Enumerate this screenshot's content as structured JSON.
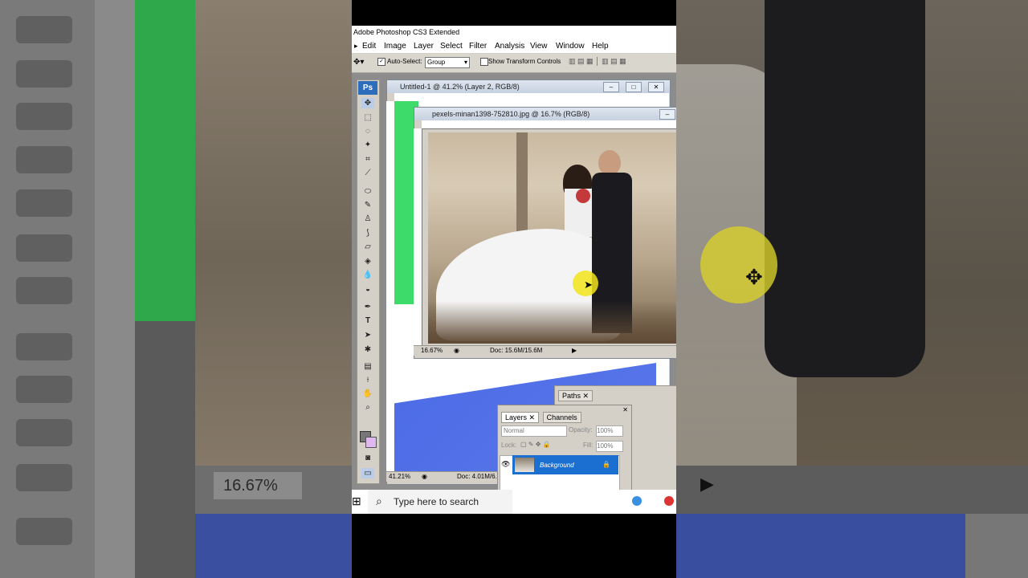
{
  "app": {
    "title": "Adobe Photoshop CS3 Extended"
  },
  "menu": [
    "Edit",
    "Image",
    "Layer",
    "Select",
    "Filter",
    "Analysis",
    "View",
    "Window",
    "Help"
  ],
  "options": {
    "auto_select_label": "Auto-Select:",
    "auto_select_value": "Group",
    "transform_label": "Show Transform Controls"
  },
  "doc_untitled": {
    "title": "Untitled-1 @ 41.2% (Layer 2, RGB/8)",
    "zoom": "41.21%",
    "doc_info": "Doc: 4.01M/6..."
  },
  "doc_photo": {
    "title": "pexels-minan1398-752810.jpg @ 16.7% (RGB/8)",
    "zoom": "16.67%",
    "doc_info": "Doc: 15.6M/15.6M"
  },
  "paths_tab": "Paths",
  "layers_panel": {
    "tabs": [
      "Layers",
      "Channels"
    ],
    "blend_mode": "Normal",
    "opacity_label": "Opacity:",
    "opacity_value": "100%",
    "lock_label": "Lock:",
    "fill_label": "Fill:",
    "fill_value": "100%",
    "layer_name": "Background"
  },
  "taskbar": {
    "search_placeholder": "Type here to search"
  },
  "background_zoom": "16.67%",
  "colors": {
    "selection_blue": "#1b6fd1",
    "ps_blue": "#2e6dbb",
    "canvas_green": "#3ddc6a",
    "cursor_highlight": "#f2e41a"
  }
}
